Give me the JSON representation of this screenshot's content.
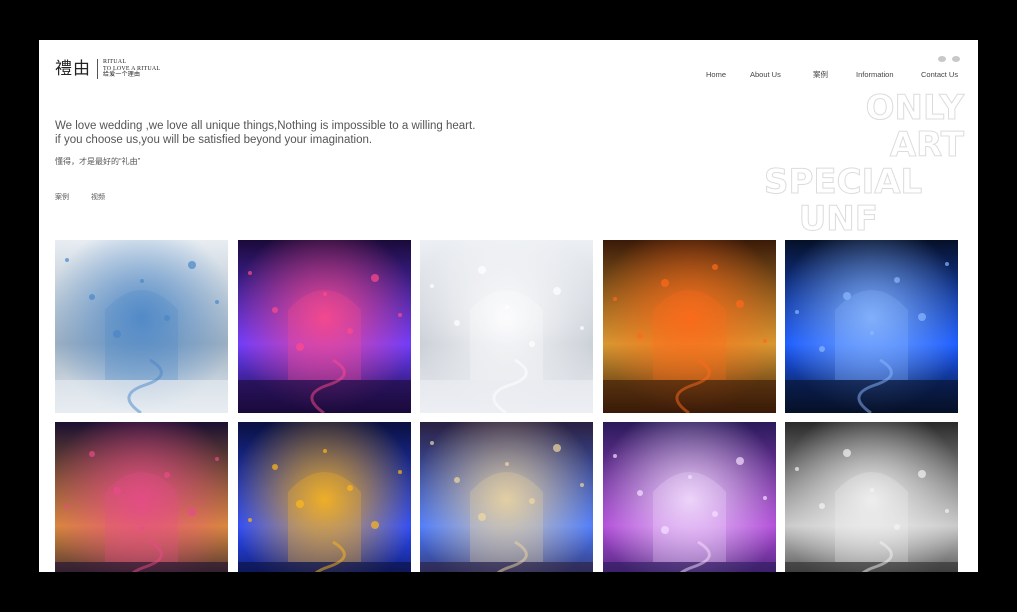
{
  "brand": {
    "logo_mark": "禮由",
    "line1": "RITUAL",
    "line2": "TO LOVE A RITUAL",
    "line3": "给爱一个理由"
  },
  "social_icons": [
    "weibo-icon",
    "wechat-icon"
  ],
  "nav": {
    "items": [
      {
        "label": "Home"
      },
      {
        "label": "About Us"
      },
      {
        "label": "案例"
      },
      {
        "label": "Information"
      },
      {
        "label": "Contact Us"
      }
    ]
  },
  "watermark": {
    "lines": [
      "ONLY",
      "ART",
      "SPECIAL",
      "UNF"
    ]
  },
  "intro": {
    "line1": "We love wedding ,we love all unique things,Nothing is impossible to a willing heart.",
    "line2": "if you choose us,you will be satisfied beyond your imagination.",
    "tagline": "懂得，才是最好的“礼由”"
  },
  "filters": [
    {
      "label": "案例"
    },
    {
      "label": "视频"
    }
  ],
  "gallery": {
    "items": [
      {
        "theme": "white-arch-stage",
        "colors": [
          "#e8edf2",
          "#9fb1c2",
          "#4a86c8"
        ]
      },
      {
        "theme": "neon-purple-stage",
        "colors": [
          "#1a0a3a",
          "#6a3cff",
          "#ff4a8a"
        ]
      },
      {
        "theme": "white-pegasus",
        "colors": [
          "#eceff3",
          "#c9ced6",
          "#ffffff"
        ]
      },
      {
        "theme": "golden-arches",
        "colors": [
          "#3a1a08",
          "#d69a32",
          "#ff6a1a"
        ]
      },
      {
        "theme": "blue-light-hall",
        "colors": [
          "#061028",
          "#1a5aff",
          "#8ab8ff"
        ]
      },
      {
        "theme": "floral-trees",
        "colors": [
          "#1a1030",
          "#d88a3a",
          "#e84a8a"
        ]
      },
      {
        "theme": "blue-gold-lights",
        "colors": [
          "#0a1040",
          "#2a4aff",
          "#ffb81a"
        ]
      },
      {
        "theme": "blue-wings",
        "colors": [
          "#2a2040",
          "#4a7aff",
          "#f0d8a0"
        ]
      },
      {
        "theme": "purple-ballroom",
        "colors": [
          "#2a1a5a",
          "#b04ad8",
          "#f5e0ff"
        ]
      },
      {
        "theme": "white-feather-arch",
        "colors": [
          "#2a2a2a",
          "#c8c8c8",
          "#f4f4f4"
        ]
      }
    ]
  }
}
